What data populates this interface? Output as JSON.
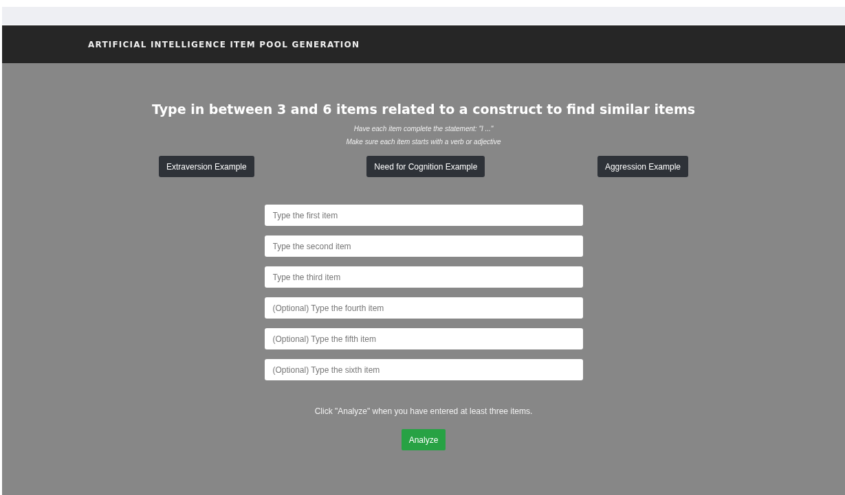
{
  "navbar": {
    "brand": "ARTIFICIAL INTELLIGENCE ITEM POOL GENERATION"
  },
  "heading": "Type in between 3 and 6 items related to a construct to find similar items",
  "instructions": [
    "Have each item complete the statement: \"I ...\"",
    "Make sure each item starts with a verb or adjective"
  ],
  "example_buttons": [
    "Extraversion Example",
    "Need for Cognition Example",
    "Aggression Example"
  ],
  "fields": [
    {
      "placeholder": "Type the first item"
    },
    {
      "placeholder": "Type the second item"
    },
    {
      "placeholder": "Type the third item"
    },
    {
      "placeholder": "(Optional) Type the fourth item"
    },
    {
      "placeholder": "(Optional) Type the fifth item"
    },
    {
      "placeholder": "(Optional) Type the sixth item"
    }
  ],
  "hint": "Click \"Analyze\" when you have entered at least three items.",
  "analyze_button": "Analyze"
}
